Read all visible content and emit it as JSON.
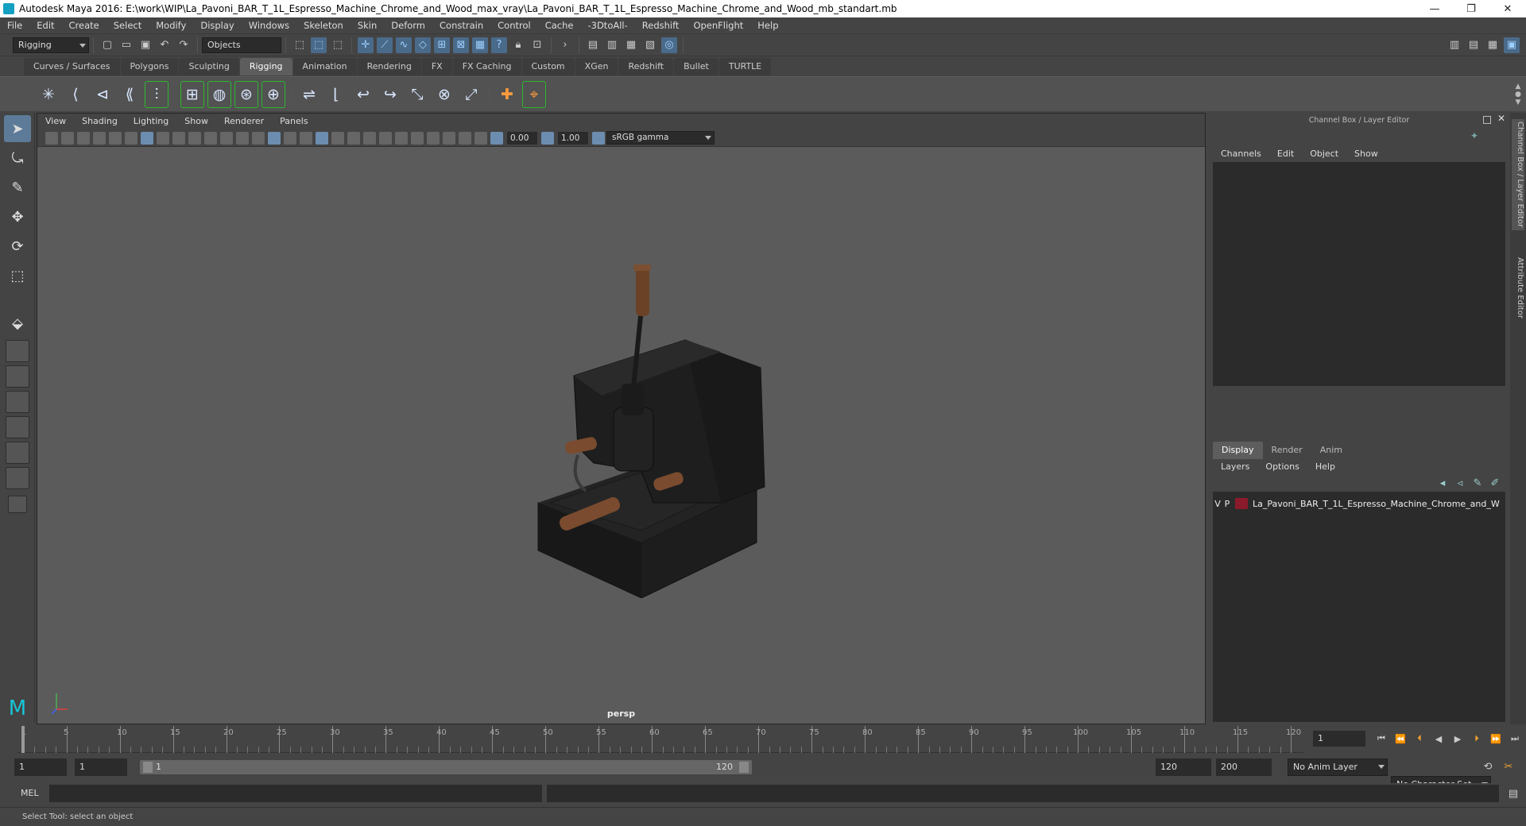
{
  "window": {
    "title": "Autodesk Maya 2016: E:\\work\\WIP\\La_Pavoni_BAR_T_1L_Espresso_Machine_Chrome_and_Wood_max_vray\\La_Pavoni_BAR_T_1L_Espresso_Machine_Chrome_and_Wood_mb_standart.mb",
    "minimize": "—",
    "restore": "❐",
    "close": "✕"
  },
  "menubar": [
    "File",
    "Edit",
    "Create",
    "Select",
    "Modify",
    "Display",
    "Windows",
    "Skeleton",
    "Skin",
    "Deform",
    "Constrain",
    "Control",
    "Cache",
    "-3DtoAll-",
    "Redshift",
    "OpenFlight",
    "Help"
  ],
  "statusline": {
    "menuset": "Rigging",
    "selection_mode": "Objects"
  },
  "shelf_tabs": [
    {
      "label": "Curves / Surfaces",
      "active": false
    },
    {
      "label": "Polygons",
      "active": false
    },
    {
      "label": "Sculpting",
      "active": false
    },
    {
      "label": "Rigging",
      "active": true
    },
    {
      "label": "Animation",
      "active": false
    },
    {
      "label": "Rendering",
      "active": false
    },
    {
      "label": "FX",
      "active": false
    },
    {
      "label": "FX Caching",
      "active": false
    },
    {
      "label": "Custom",
      "active": false
    },
    {
      "label": "XGen",
      "active": false
    },
    {
      "label": "Redshift",
      "active": false
    },
    {
      "label": "Bullet",
      "active": false
    },
    {
      "label": "TURTLE",
      "active": false
    }
  ],
  "viewport": {
    "menu": [
      "View",
      "Shading",
      "Lighting",
      "Show",
      "Renderer",
      "Panels"
    ],
    "exposure": "0.00",
    "gamma": "1.00",
    "colorspace": "sRGB gamma",
    "camera": "persp"
  },
  "channel_box": {
    "title": "Channel Box / Layer Editor",
    "menu": [
      "Channels",
      "Edit",
      "Object",
      "Show"
    ]
  },
  "layer_editor": {
    "tabs": [
      {
        "label": "Display",
        "active": true
      },
      {
        "label": "Render",
        "active": false
      },
      {
        "label": "Anim",
        "active": false
      }
    ],
    "menu": [
      "Layers",
      "Options",
      "Help"
    ],
    "layers": [
      {
        "v": "V",
        "p": "P",
        "name": "La_Pavoni_BAR_T_1L_Espresso_Machine_Chrome_and_W",
        "color": "#8b1a2a"
      }
    ]
  },
  "side_tabs": [
    "Channel Box / Layer Editor",
    "Attribute Editor"
  ],
  "timeslider": {
    "labels": [
      "1",
      "5",
      "10",
      "15",
      "20",
      "25",
      "30",
      "35",
      "40",
      "45",
      "50",
      "55",
      "60",
      "65",
      "70",
      "75",
      "80",
      "85",
      "90",
      "95",
      "100",
      "105",
      "110",
      "115",
      "120"
    ],
    "current_frame": "1"
  },
  "rangeslider": {
    "start": "1",
    "playback_start": "1",
    "range_start_label": "1",
    "range_end_label": "120",
    "playback_end": "120",
    "end": "200",
    "anim_layer": "No Anim Layer",
    "character_set": "No Character Set"
  },
  "cmdline": {
    "label": "MEL"
  },
  "helpline": {
    "text": "Select Tool: select an object"
  }
}
